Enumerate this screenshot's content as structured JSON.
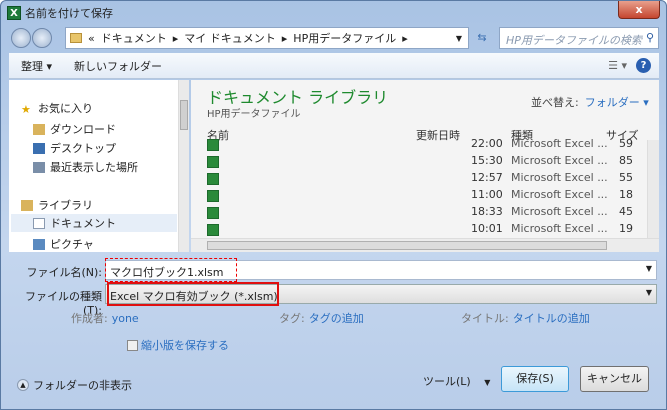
{
  "window": {
    "title": "名前を付けて保存",
    "close": "x"
  },
  "address": {
    "crumbs": [
      "ドキュメント",
      "マイ ドキュメント",
      "HP用データファイル"
    ],
    "search_placeholder": "HP用データファイルの検索"
  },
  "toolbar": {
    "organize": "整理 ▾",
    "new_folder": "新しいフォルダー"
  },
  "sidebar": {
    "favorites": "お気に入り",
    "items": [
      "ダウンロード",
      "デスクトップ",
      "最近表示した場所"
    ],
    "libraries": "ライブラリ",
    "lib_items": [
      "ドキュメント",
      "ピクチャ"
    ]
  },
  "main": {
    "title": "ドキュメント ライブラリ",
    "subtitle": "HP用データファイル",
    "sort_label": "並べ替え:",
    "sort_value": "フォルダー ▾",
    "columns": [
      "名前",
      "更新日時",
      "種類",
      "サイズ"
    ],
    "rows": [
      {
        "time": "22:00",
        "type": "Microsoft Excel ...",
        "size": "59"
      },
      {
        "time": "15:30",
        "type": "Microsoft Excel ...",
        "size": "85"
      },
      {
        "time": "12:57",
        "type": "Microsoft Excel ...",
        "size": "55"
      },
      {
        "time": "11:00",
        "type": "Microsoft Excel ...",
        "size": "18"
      },
      {
        "time": "18:33",
        "type": "Microsoft Excel ...",
        "size": "45"
      },
      {
        "time": "10:01",
        "type": "Microsoft Excel ...",
        "size": "19"
      }
    ]
  },
  "form": {
    "filename_label": "ファイル名(N):",
    "filename": "マクロ付ブック1.xlsm",
    "filetype_label": "ファイルの種類(T):",
    "filetype": "Excel マクロ有効ブック (*.xlsm)",
    "author_label": "作成者:",
    "author": "yone",
    "tag_label": "タグ:",
    "tag": "タグの追加",
    "title_label": "タイトル:",
    "title": "タイトルの追加",
    "thumbnail": "縮小版を保存する"
  },
  "footer": {
    "hide_folders": "フォルダーの非表示",
    "tools": "ツール(L)",
    "save": "保存(S)",
    "cancel": "キャンセル"
  }
}
